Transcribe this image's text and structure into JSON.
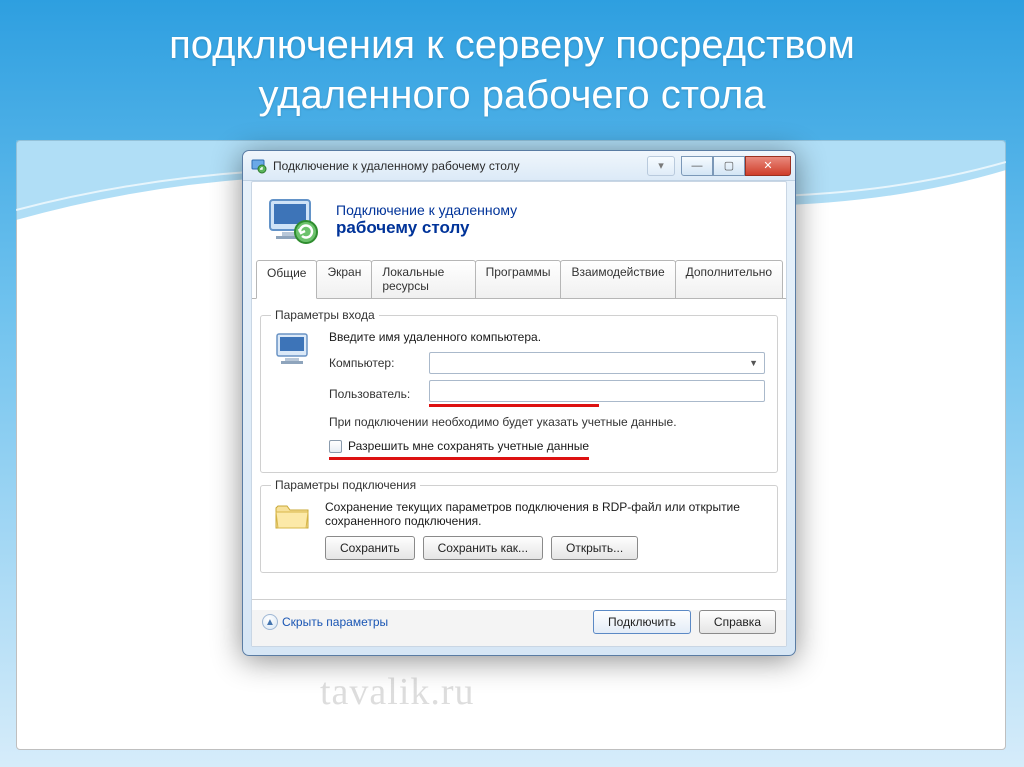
{
  "slide": {
    "title": "подключения к серверу посредством удаленного рабочего стола"
  },
  "window": {
    "title": "Подключение к удаленному рабочему столу",
    "header": {
      "line1": "Подключение к удаленному",
      "line2": "рабочему столу"
    },
    "tabs": [
      "Общие",
      "Экран",
      "Локальные ресурсы",
      "Программы",
      "Взаимодействие",
      "Дополнительно"
    ],
    "login": {
      "group_title": "Параметры входа",
      "instruction": "Введите имя удаленного компьютера.",
      "computer_label": "Компьютер:",
      "computer_value": "",
      "user_label": "Пользователь:",
      "user_value": "",
      "help_text": "При подключении необходимо будет указать учетные данные.",
      "allow_save_label": "Разрешить мне сохранять учетные данные"
    },
    "connection": {
      "group_title": "Параметры подключения",
      "text": "Сохранение текущих параметров подключения в RDP-файл или открытие сохраненного подключения.",
      "save": "Сохранить",
      "save_as": "Сохранить как...",
      "open": "Открыть..."
    },
    "footer": {
      "hide_params": "Скрыть параметры",
      "connect": "Подключить",
      "help": "Справка"
    }
  },
  "watermark": "tavalik.ru"
}
